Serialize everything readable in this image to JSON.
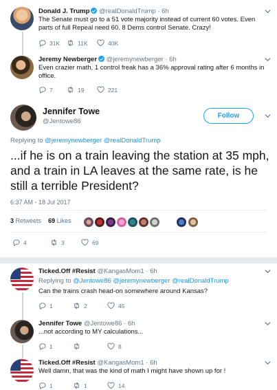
{
  "tweets_above": [
    {
      "name": "Donald J. Trump",
      "handle": "@realDonaldTrump",
      "time": "· 6h",
      "text": "The Senate must go to a 51 vote majority instead of current 60 votes. Even parts of full Repeal need 60. 8 Dems control Senate. Crazy!",
      "replies": "31K",
      "retweets": "11K",
      "likes": "40K"
    },
    {
      "name": "Jeremy Newberger",
      "handle": "@jeremynewberger",
      "time": "· 6h",
      "text": "Even crazier math, 1 control freak has a 36% approval rating after 6 months in office.",
      "replies": "7",
      "retweets": "19",
      "likes": "221"
    }
  ],
  "main": {
    "name": "Jennifer Towe",
    "handle": "@Jentowe86",
    "follow_label": "Follow",
    "replying_prefix": "Replying to",
    "replying_to": "@jeremynewberger @realDonaldTrump",
    "text": "...if he is on a train leaving the station at 35 mph, and a train in LA leaves at the same rate, is he still a terrible President?",
    "timestamp": "6:37 AM - 18 Jul 2017",
    "retweets_count": "3",
    "retweets_label": "Retweets",
    "likes_count": "69",
    "likes_label": "Likes",
    "replies": "4",
    "retweets": "3",
    "likes": "69"
  },
  "replies": [
    {
      "name": "Ticked.Off #Resist",
      "handle": "@KangasMom1",
      "time": "· 6h",
      "replying_prefix": "Replying to",
      "replying_to": "@Jentowe86 @jeremynewberger @realDonaldTrump",
      "text": "Can the trains crash head-on somewhere around Kansas?",
      "replies": "1",
      "retweets": "2",
      "likes": "45"
    },
    {
      "name": "Jennifer Towe",
      "handle": "@Jentowe86",
      "time": "· 6h",
      "text": "...not according to MY calculations...",
      "replies": "1",
      "retweets": "",
      "likes": "8"
    },
    {
      "name": "Ticked.Off #Resist",
      "handle": "@KangasMom1",
      "time": "· 6h",
      "text": "Well damn, that was the kind of math I might have shown up for !",
      "replies": "1",
      "retweets": "1",
      "likes": "14"
    }
  ]
}
